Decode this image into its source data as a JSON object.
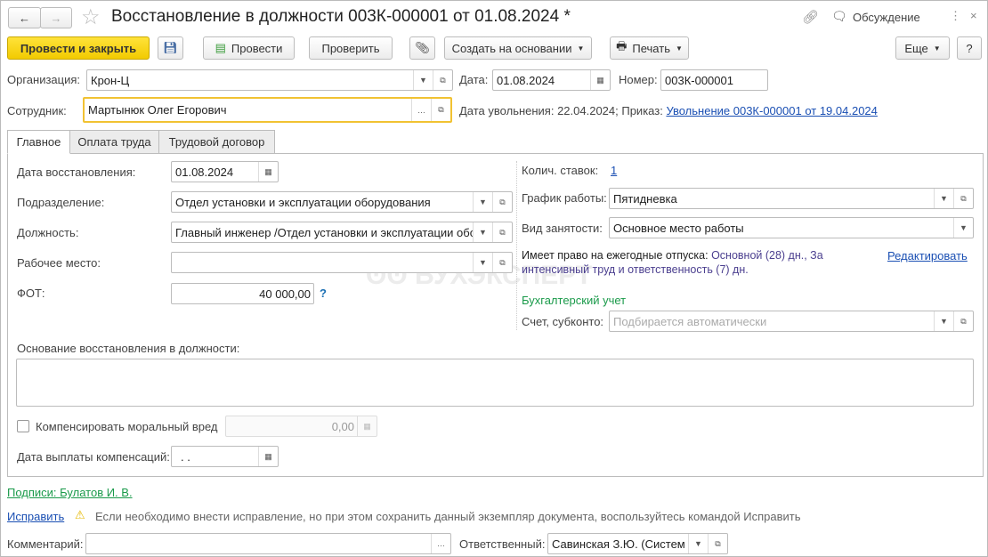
{
  "header": {
    "title": "Восстановление в должности 003К-000001 от 01.08.2024 *",
    "discussion": "Обсуждение"
  },
  "toolbar": {
    "post_close": "Провести и закрыть",
    "post": "Провести",
    "check": "Проверить",
    "create_based": "Создать на основании",
    "print": "Печать",
    "more": "Еще",
    "help": "?"
  },
  "org": {
    "label": "Организация:",
    "value": "Крон-Ц"
  },
  "date": {
    "label": "Дата:",
    "value": "01.08.2024"
  },
  "number": {
    "label": "Номер:",
    "value": "003К-000001"
  },
  "employee": {
    "label": "Сотрудник:",
    "value": "Мартынюк Олег Егорович",
    "dismissal_text": "Дата увольнения: 22.04.2024; Приказ:",
    "dismissal_link": "Увольнение 003К-000001 от 19.04.2024"
  },
  "tabs": [
    {
      "label": "Главное"
    },
    {
      "label": "Оплата труда"
    },
    {
      "label": "Трудовой договор"
    }
  ],
  "main": {
    "restore_date": {
      "label": "Дата восстановления:",
      "value": "01.08.2024"
    },
    "department": {
      "label": "Подразделение:",
      "value": "Отдел установки и эксплуатации оборудования"
    },
    "position": {
      "label": "Должность:",
      "value": "Главный инженер /Отдел установки и эксплуатации обо"
    },
    "workplace": {
      "label": "Рабочее место:",
      "value": ""
    },
    "fot": {
      "label": "ФОТ:",
      "value": "40 000,00",
      "hint": "?"
    },
    "rates": {
      "label": "Колич. ставок:",
      "value": "1"
    },
    "schedule": {
      "label": "График работы:",
      "value": "Пятидневка"
    },
    "employment": {
      "label": "Вид занятости:",
      "value": "Основное место работы"
    },
    "vacation": {
      "label": "Имеет право на ежегодные отпуска:",
      "line1": "Основной (28) дн., За",
      "line2": "интенсивный труд и ответственность (7) дн.",
      "edit": "Редактировать"
    },
    "accounting": {
      "title": "Бухгалтерский учет",
      "label": "Счет, субконто:",
      "placeholder": "Подбирается автоматически"
    },
    "basis": {
      "label": "Основание восстановления в должности:",
      "value": ""
    },
    "compensate": {
      "label": "Компенсировать моральный вред",
      "checked": false,
      "value": "0,00"
    },
    "payment_date": {
      "label": "Дата выплаты компенсаций:",
      "value": " .  ."
    }
  },
  "footer": {
    "signatures": "Подписи: Булатов И. В.",
    "fix_link": "Исправить",
    "fix_hint": "Если необходимо внести исправление, но при этом сохранить данный экземпляр документа, воспользуйтесь командой Исправить",
    "comment_label": "Комментарий:",
    "comment": "",
    "responsible_label": "Ответственный:",
    "responsible": "Савинская З.Ю. (Систем"
  }
}
